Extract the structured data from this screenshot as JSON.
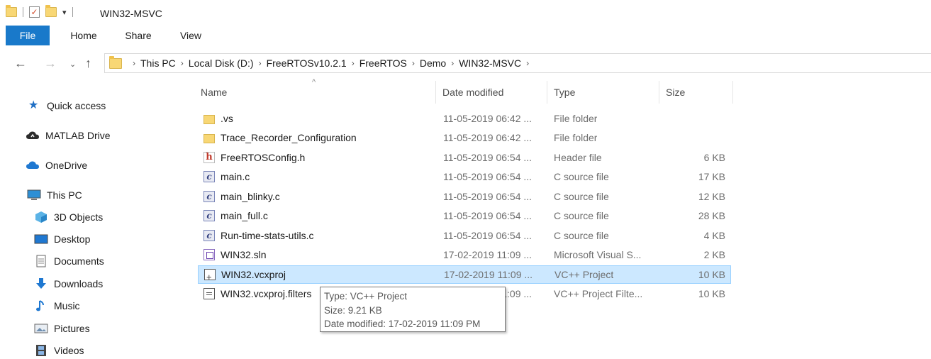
{
  "window": {
    "title": "WIN32-MSVC"
  },
  "ribbon": {
    "tabs": [
      "File",
      "Home",
      "Share",
      "View"
    ]
  },
  "address": {
    "crumbs": [
      "This PC",
      "Local Disk (D:)",
      "FreeRTOSv10.2.1",
      "FreeRTOS",
      "Demo",
      "WIN32-MSVC"
    ]
  },
  "sidebar": {
    "items": [
      {
        "label": "Quick access",
        "icon": "star-icon"
      },
      {
        "label": "MATLAB Drive",
        "icon": "cloud-icon"
      },
      {
        "label": "OneDrive",
        "icon": "cloud-icon"
      },
      {
        "label": "This PC",
        "icon": "computer-icon"
      },
      {
        "label": "3D Objects",
        "icon": "cube-icon"
      },
      {
        "label": "Desktop",
        "icon": "desktop-icon"
      },
      {
        "label": "Documents",
        "icon": "document-icon"
      },
      {
        "label": "Downloads",
        "icon": "download-arrow-icon"
      },
      {
        "label": "Music",
        "icon": "music-note-icon"
      },
      {
        "label": "Pictures",
        "icon": "picture-icon"
      },
      {
        "label": "Videos",
        "icon": "film-icon"
      }
    ]
  },
  "columns": {
    "name": "Name",
    "date": "Date modified",
    "type": "Type",
    "size": "Size"
  },
  "files": [
    {
      "name": ".vs",
      "date": "11-05-2019 06:42 ...",
      "type": "File folder",
      "size": "",
      "icon": "folder"
    },
    {
      "name": "Trace_Recorder_Configuration",
      "date": "11-05-2019 06:42 ...",
      "type": "File folder",
      "size": "",
      "icon": "folder"
    },
    {
      "name": "FreeRTOSConfig.h",
      "date": "11-05-2019 06:54 ...",
      "type": "Header file",
      "size": "6 KB",
      "icon": "h"
    },
    {
      "name": "main.c",
      "date": "11-05-2019 06:54 ...",
      "type": "C source file",
      "size": "17 KB",
      "icon": "c"
    },
    {
      "name": "main_blinky.c",
      "date": "11-05-2019 06:54 ...",
      "type": "C source file",
      "size": "12 KB",
      "icon": "c"
    },
    {
      "name": "main_full.c",
      "date": "11-05-2019 06:54 ...",
      "type": "C source file",
      "size": "28 KB",
      "icon": "c"
    },
    {
      "name": "Run-time-stats-utils.c",
      "date": "11-05-2019 06:54 ...",
      "type": "C source file",
      "size": "4 KB",
      "icon": "c"
    },
    {
      "name": "WIN32.sln",
      "date": "17-02-2019 11:09 ...",
      "type": "Microsoft Visual S...",
      "size": "2 KB",
      "icon": "sln"
    },
    {
      "name": "WIN32.vcxproj",
      "date": "17-02-2019 11:09 ...",
      "type": "VC++ Project",
      "size": "10 KB",
      "icon": "proj",
      "selected": true
    },
    {
      "name": "WIN32.vcxproj.filters",
      "date": "17-02-2019 11:09 ...",
      "type": "VC++ Project Filte...",
      "size": "10 KB",
      "icon": "filt"
    }
  ],
  "tooltip": {
    "type": "Type: VC++ Project",
    "size": "Size: 9.21 KB",
    "date": "Date modified: 17-02-2019 11:09 PM"
  },
  "colors": {
    "accent": "#1979ca",
    "selection": "#cce8ff",
    "selection_border": "#99d1ff"
  }
}
